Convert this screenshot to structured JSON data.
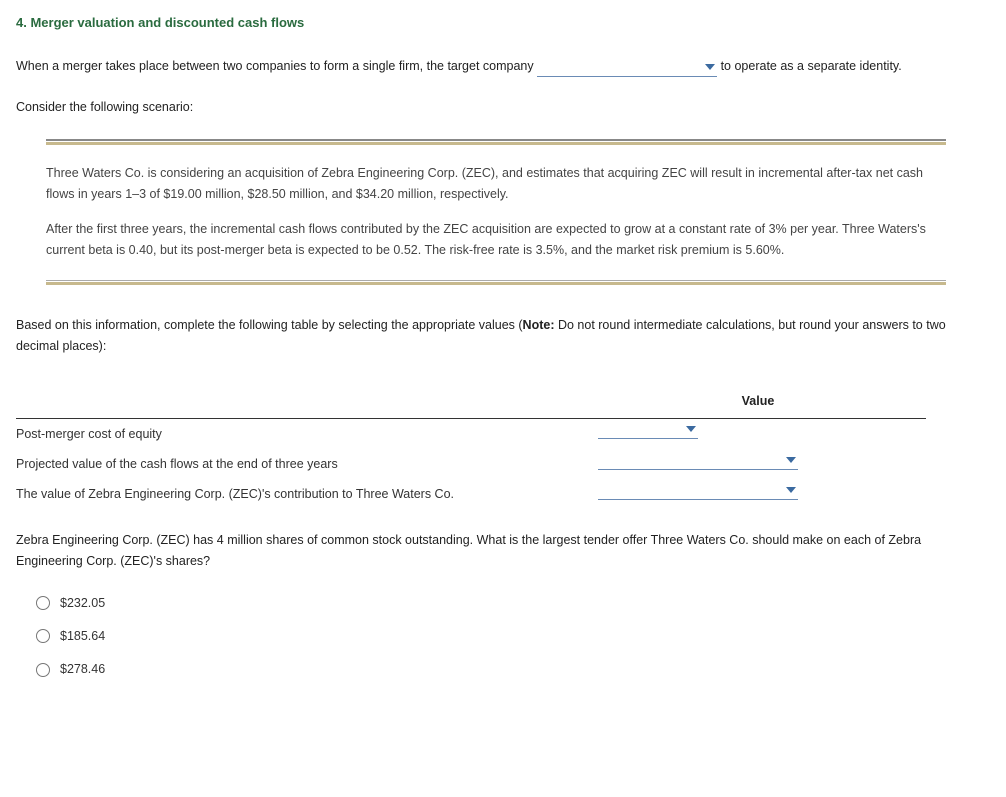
{
  "heading": "4. Merger valuation and discounted cash flows",
  "intro": {
    "before": "When a merger takes place between two companies to form a single firm, the target company ",
    "after": " to operate as a separate identity."
  },
  "consider": "Consider the following scenario:",
  "scenario": {
    "p1": "Three Waters Co. is considering an acquisition of Zebra Engineering Corp. (ZEC), and estimates that acquiring ZEC will result in incremental after-tax net cash flows in years 1–3 of $19.00 million, $28.50 million, and $34.20 million, respectively.",
    "p2": "After the first three years, the incremental cash flows contributed by the ZEC acquisition are expected to grow at a constant rate of 3% per year. Three Waters's current beta is 0.40, but its post-merger beta is expected to be 0.52. The risk-free rate is 3.5%, and the market risk premium is 5.60%."
  },
  "instructions": {
    "before": "Based on this information, complete the following table by selecting the appropriate values (",
    "bold": "Note:",
    "after": " Do not round intermediate calculations, but round your answers to two decimal places):"
  },
  "table": {
    "header_value": "Value",
    "rows": [
      {
        "label": "Post-merger cost of equity",
        "width": "w-small"
      },
      {
        "label": "Projected value of the cash flows at the end of three years",
        "width": "w-large"
      },
      {
        "label": "The value of Zebra Engineering Corp. (ZEC)'s contribution to Three Waters Co.",
        "width": "w-large"
      }
    ]
  },
  "question2": "Zebra Engineering Corp. (ZEC) has 4 million shares of common stock outstanding. What is the largest tender offer Three Waters Co. should make on each of Zebra Engineering Corp. (ZEC)'s shares?",
  "options": [
    "$232.05",
    "$185.64",
    "$278.46"
  ]
}
